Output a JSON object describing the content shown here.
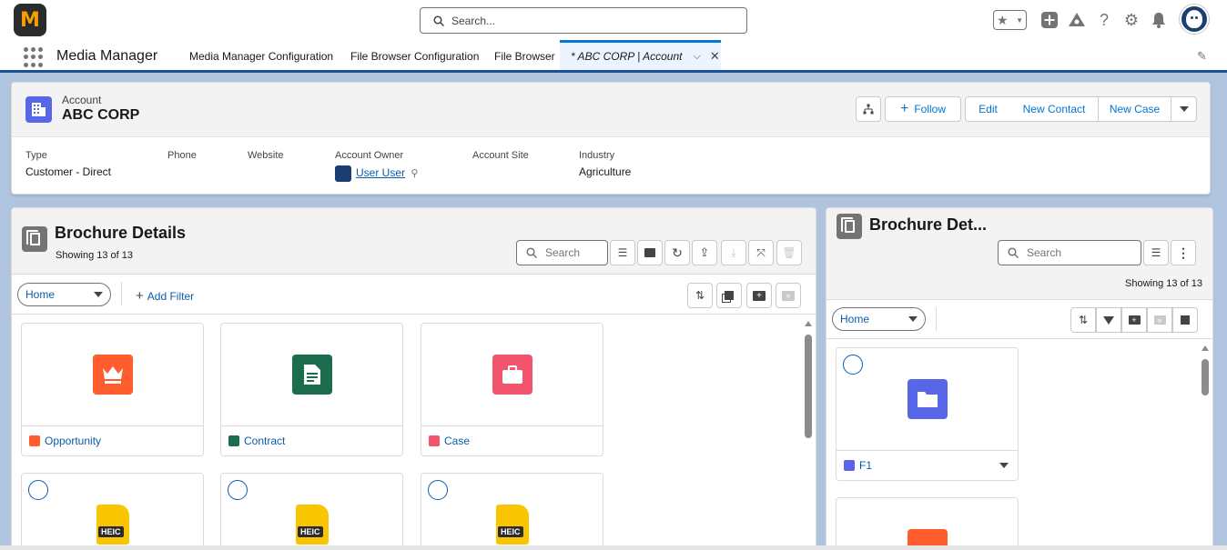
{
  "header": {
    "logo_letter": "M",
    "search_placeholder": "Search...",
    "icons": [
      "favorites-star-icon",
      "add-icon",
      "trailhead-icon",
      "help-icon",
      "settings-gear-icon",
      "notification-bell-icon"
    ]
  },
  "nav": {
    "app_name": "Media Manager",
    "items": [
      "Media Manager Configuration",
      "File Browser Configuration",
      "File Browser"
    ],
    "active_tab": "* ABC CORP | Account"
  },
  "record": {
    "object_label": "Account",
    "name": "ABC CORP",
    "actions": {
      "follow": "Follow",
      "edit": "Edit",
      "new_contact": "New Contact",
      "new_case": "New Case"
    },
    "fields": [
      {
        "label": "Type",
        "value": "Customer - Direct"
      },
      {
        "label": "Phone",
        "value": ""
      },
      {
        "label": "Website",
        "value": ""
      },
      {
        "label": "Account Owner",
        "value": "User User"
      },
      {
        "label": "Account Site",
        "value": ""
      },
      {
        "label": "Industry",
        "value": "Agriculture"
      }
    ]
  },
  "main_panel": {
    "title": "Brochure Details",
    "showing": "Showing 13 of 13",
    "search_placeholder": "Search",
    "folder_select": "Home",
    "add_filter": "Add Filter",
    "tiles": [
      {
        "label": "Opportunity",
        "icon": "opportunity-crown-icon",
        "color": "#ff5d2d"
      },
      {
        "label": "Contract",
        "icon": "contract-document-icon",
        "color": "#1b6d4e"
      },
      {
        "label": "Case",
        "icon": "case-briefcase-icon",
        "color": "#f2536d"
      }
    ],
    "heic_badge": "HEIC"
  },
  "side_panel": {
    "title": "Brochure Det...",
    "search_placeholder": "Search",
    "showing": "Showing 13 of 13",
    "folder_select": "Home",
    "folder_tile": {
      "label": "F1",
      "icon": "folder-icon",
      "color": "#5867e8"
    }
  }
}
